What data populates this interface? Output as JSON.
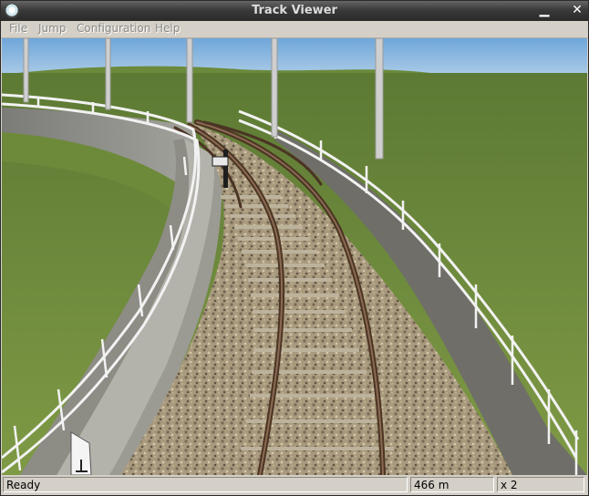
{
  "window": {
    "title": "Track Viewer"
  },
  "menu": {
    "items": [
      "File",
      "Jump",
      "Configuration",
      "Help"
    ]
  },
  "status": {
    "text": "Ready",
    "distance": "466 m",
    "speed": "x 2"
  }
}
